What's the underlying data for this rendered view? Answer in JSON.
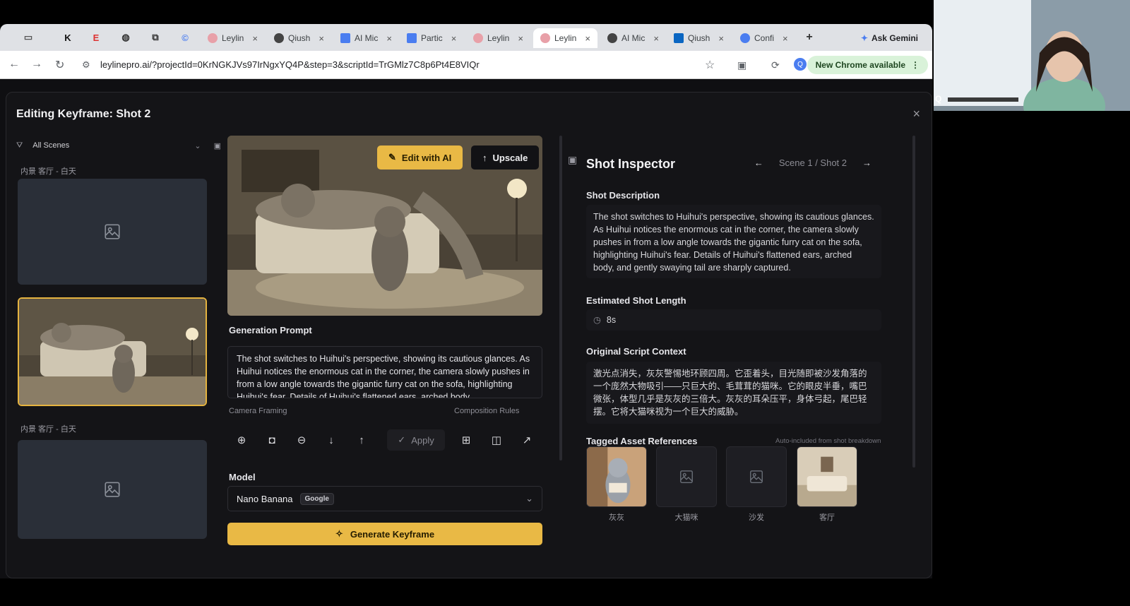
{
  "browser": {
    "tabs": [
      {
        "label": "Leylin",
        "color": "#e8a0a8"
      },
      {
        "label": "Qiush",
        "color": "#444"
      },
      {
        "label": "AI Mic",
        "color": "#4a7df0"
      },
      {
        "label": "Partic",
        "color": "#4a7df0"
      },
      {
        "label": "Leylin",
        "color": "#e8a0a8"
      },
      {
        "label": "Leylin",
        "color": "#e8a0a8"
      },
      {
        "label": "AI Mic",
        "color": "#444"
      },
      {
        "label": "Qiush",
        "color": "#0a66c2"
      },
      {
        "label": "Confi",
        "color": "#4a7df0"
      }
    ],
    "ask_gemini": "Ask Gemini",
    "url": "leylinepro.ai/?projectId=0KrNGKJVs97IrNgxYQ4P&step=3&scriptId=TrGMlz7C8p6Pt4E8VIQr",
    "new_chrome": "New Chrome available"
  },
  "modal": {
    "title": "Editing Keyframe: Shot 2",
    "close": "×"
  },
  "left": {
    "filter": "All Scenes",
    "scene_labels": [
      "内景 客厅 - 白天",
      "内景 客厅 - 白天"
    ]
  },
  "center": {
    "edit_with_ai": "Edit with AI",
    "upscale": "Upscale",
    "generation_prompt_label": "Generation Prompt",
    "generation_prompt": "The shot switches to Huihui's perspective, showing its cautious glances. As Huihui notices the enormous cat in the corner, the camera slowly pushes in from a low angle towards the gigantic furry cat on the sofa, highlighting Huihui's fear. Details of Huihui's flattened ears, arched body",
    "camera_framing_label": "Camera Framing",
    "composition_rules_label": "Composition Rules",
    "apply": "Apply",
    "model_label": "Model",
    "model_value": "Nano Banana",
    "model_badge": "Google",
    "generate": "Generate Keyframe"
  },
  "inspector": {
    "title": "Shot Inspector",
    "nav": "Scene 1 / Shot 2",
    "shot_description_label": "Shot Description",
    "shot_description": "The shot switches to Huihui's perspective, showing its cautious glances. As Huihui notices the enormous cat in the corner, the camera slowly pushes in from a low angle towards the gigantic furry cat on the sofa, highlighting Huihui's fear. Details of Huihui's flattened ears, arched body, and gently swaying tail are sharply captured.",
    "estimated_length_label": "Estimated Shot Length",
    "estimated_length": "8s",
    "original_context_label": "Original Script Context",
    "original_context": "激光点消失，灰灰警惕地环顾四周。它歪着头，目光随即被沙发角落的一个庞然大物吸引——只巨大的、毛茸茸的猫咪。它的眼皮半垂，嘴巴微张，体型几乎是灰灰的三倍大。灰灰的耳朵压平，身体弓起，尾巴轻摆。它将大猫咪视为一个巨大的威胁。",
    "tagged_assets_label": "Tagged Asset References",
    "auto_included": "Auto-included from shot breakdown",
    "assets": [
      "灰灰",
      "大猫咪",
      "沙发",
      "客厅"
    ]
  },
  "colors": {
    "accent": "#e9b945",
    "bg": "#141417"
  }
}
